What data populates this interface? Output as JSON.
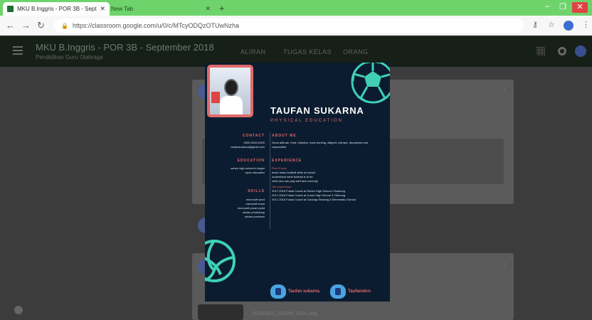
{
  "browser": {
    "tabs": [
      {
        "title": "MKU B.Inggris - POR 3B - Septe",
        "active": true
      },
      {
        "title": "New Tab",
        "active": false
      }
    ],
    "new_tab": "+",
    "url": "https://classroom.google.com/u/0/c/MTcyODQzOTUwNzha"
  },
  "classroom": {
    "title": "MKU B.Inggris - POR 3B - September 2018",
    "subtitle": "Pendidikan Guru Olahraga",
    "nav": [
      "ALIRAN",
      "TUGAS KELAS",
      "ORANG"
    ],
    "attachment": "20180922_224054_0001.png"
  },
  "resume": {
    "name": "TAUFAN SUKARNA",
    "role": "PHYSICAL EDUCATION",
    "contact": {
      "heading": "CONTACT",
      "phone": "0000-0000-0000",
      "email": "taufansukarna@gmail.com"
    },
    "education": {
      "heading": "EDUCATION",
      "school": "senior high school in bogor",
      "major": "sport education"
    },
    "skills": {
      "heading": "SKILLS",
      "items": [
        "microsoft word",
        "microsoft excel",
        "microsoft power point",
        "adobe photoshop",
        "adobe premiere"
      ]
    },
    "about": {
      "heading": "ABOUT ME",
      "line1": "Good attitude, Kind, initiative, hard working, diligent, tolerant, disciplined and",
      "line2": "responsible"
    },
    "experience": {
      "heading": "EXPERIENCE",
      "focus_heading": "Field Focus",
      "focus_items": [
        "teach basic football skills at school",
        "understand what football is to be",
        "child who can play well and correctly"
      ],
      "job_heading": "Job experience",
      "job_items": [
        "2017-2018 Futsal Coach at Senior High School 1 Bantung",
        "2017-2018 Futsal Coach at Junior High School 3 Cibinong",
        "2017-2018 Futsal Coach at Ciaduag Sindang 3 Elementary School"
      ]
    },
    "social": [
      {
        "icon": "facebook-icon",
        "label": "Taufan sukarna"
      },
      {
        "icon": "instagram-icon",
        "label": "Taufanskrn"
      }
    ]
  }
}
